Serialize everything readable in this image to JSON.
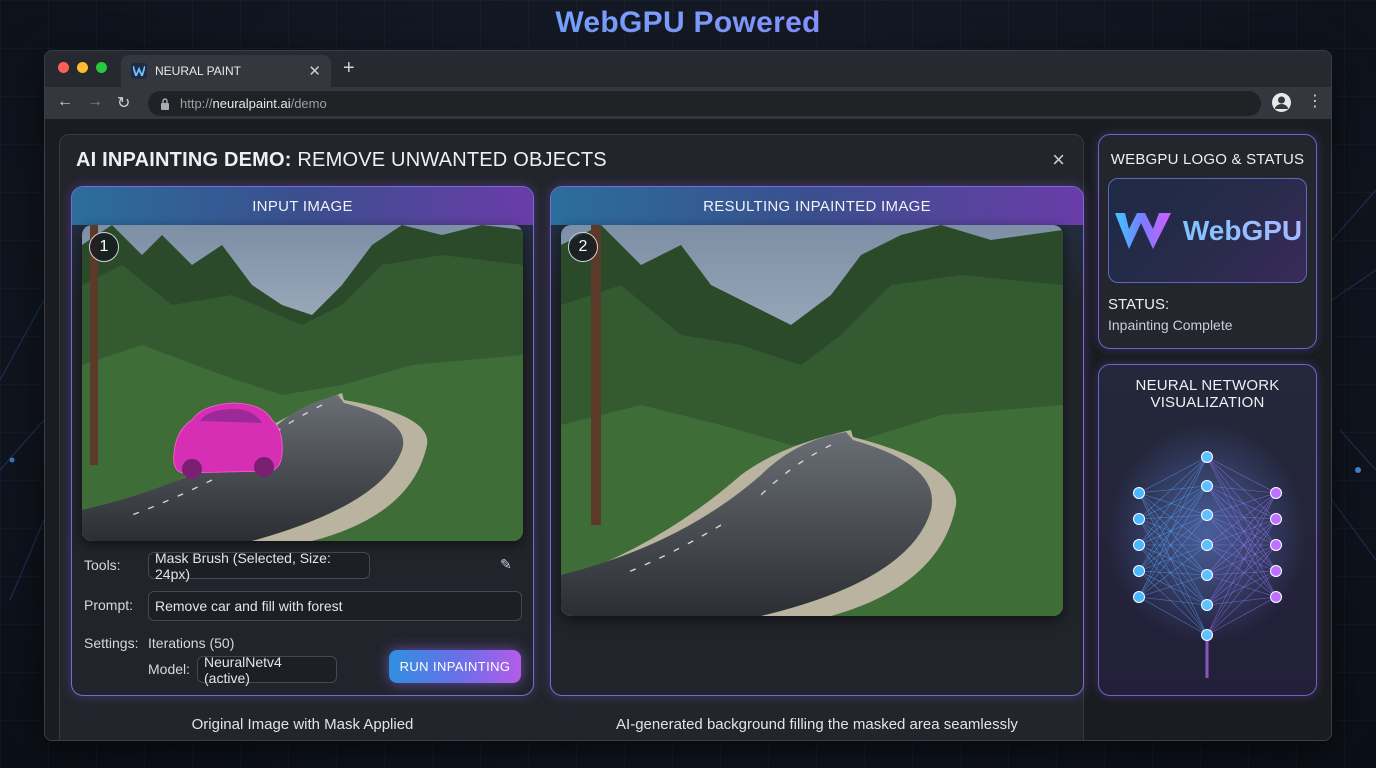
{
  "hero": {
    "title": "WebGPU Powered"
  },
  "browser": {
    "tab_title": "NEURAL PAINT",
    "url_prefix": "http://",
    "url_host": "neuralpaint.ai",
    "url_path": "/demo"
  },
  "demo": {
    "title_bold": "AI INPAINTING DEMO:",
    "title_rest": " REMOVE UNWANTED OBJECTS",
    "input_card": {
      "header": "INPUT IMAGE",
      "step": "1",
      "caption": "Original Image with Mask Applied"
    },
    "result_card": {
      "header": "RESULTING INPAINTED IMAGE",
      "step": "2",
      "caption": "AI-generated background filling the masked area seamlessly"
    },
    "controls": {
      "tools_label": "Tools:",
      "tools_value": "Mask Brush (Selected, Size: 24px)",
      "prompt_label": "Prompt:",
      "prompt_value": "Remove car and fill with forest",
      "settings_label": "Settings:",
      "iterations_value": "Iterations (50)",
      "model_label": "Model:",
      "model_value": "NeuralNetv4 (active)",
      "run_button": "RUN INPAINTING"
    }
  },
  "sidebar": {
    "status_card": {
      "title": "WEBGPU LOGO & STATUS",
      "logo_text": "WebGPU",
      "status_label": "STATUS:",
      "status_value": "Inpainting Complete"
    },
    "nn_card": {
      "title_line1": "NEURAL NETWORK",
      "title_line2": "VISUALIZATION"
    }
  },
  "colors": {
    "accent_blue": "#2f8fe0",
    "accent_purple": "#b45ce8",
    "mask_magenta": "#d62fb4"
  }
}
